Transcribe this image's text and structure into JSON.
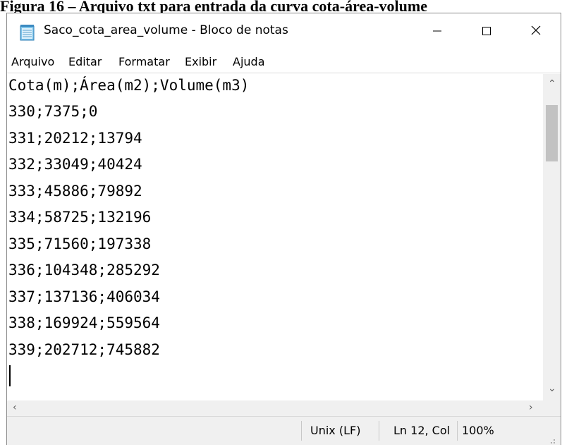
{
  "page_caption": "Figura 16 – Arquivo txt para entrada da curva cota-área-volume",
  "window": {
    "title": "Saco_cota_area_volume - Bloco de notas"
  },
  "menu": [
    "Arquivo",
    "Editar",
    "Formatar",
    "Exibir",
    "Ajuda"
  ],
  "editor": {
    "lines": [
      "Cota(m);Área(m2);Volume(m3)",
      "330;7375;0",
      "331;20212;13794",
      "332;33049;40424",
      "333;45886;79892",
      "334;58725;132196",
      "335;71560;197338",
      "336;104348;285292",
      "337;137136;406034",
      "338;169924;559564",
      "339;202712;745882"
    ]
  },
  "status": {
    "line_ending": "Unix (LF)",
    "position": "Ln 12, Col",
    "zoom": "100%"
  },
  "icons": {
    "app": "notepad-icon",
    "minimize": "minimize-icon",
    "maximize": "maximize-icon",
    "close": "close-icon"
  }
}
